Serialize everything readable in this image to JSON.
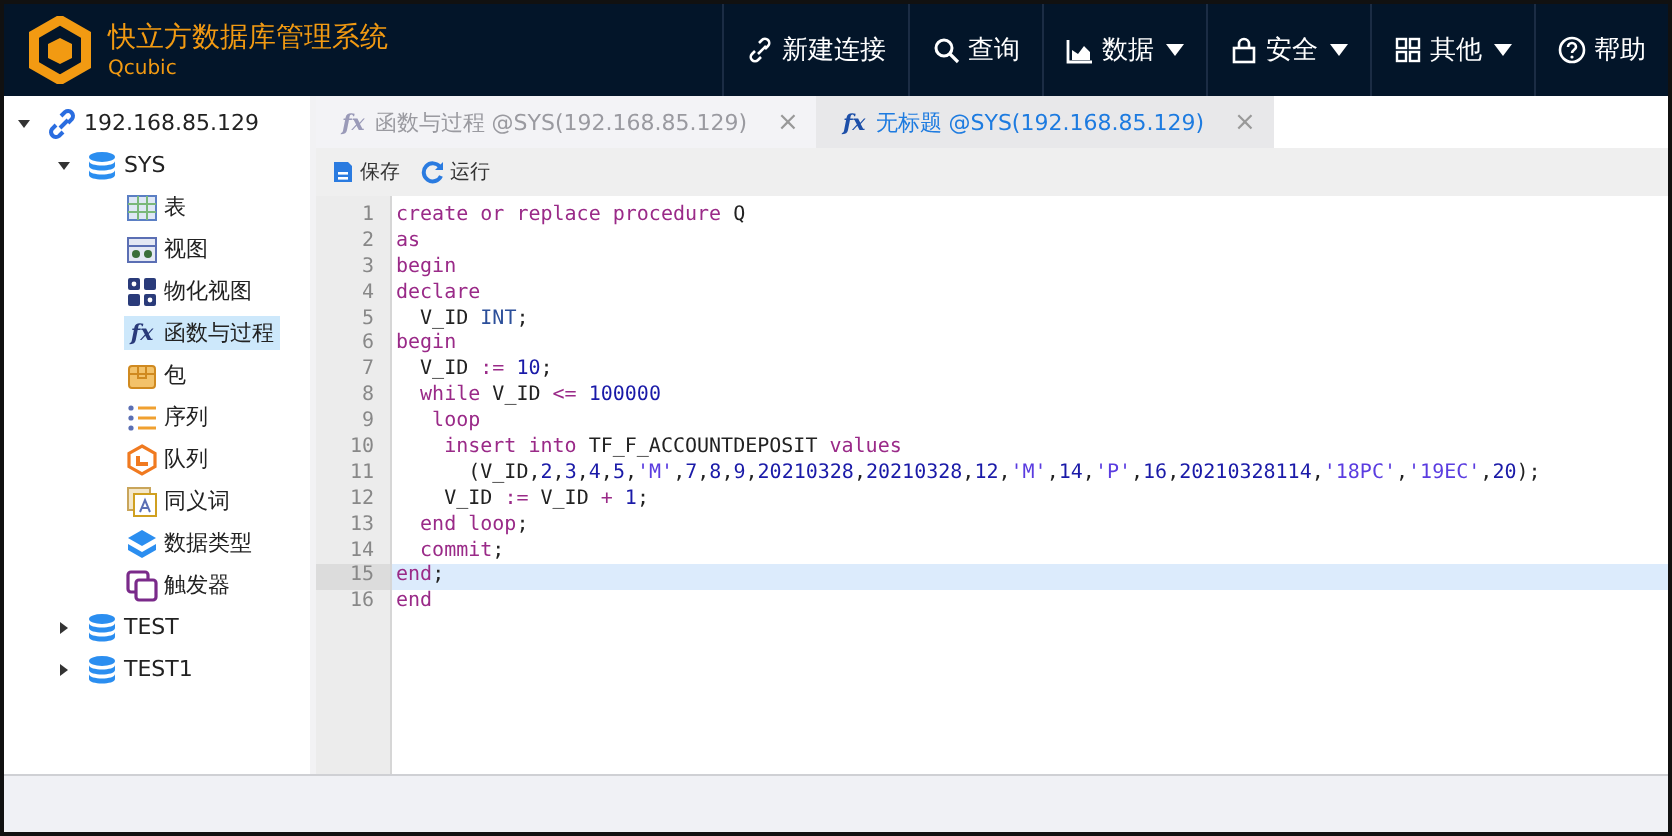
{
  "app": {
    "title": "快立方数据库管理系统",
    "subtitle": "Qcubic"
  },
  "nav": [
    {
      "kind": "link",
      "label": "新建连接",
      "dropdown": false
    },
    {
      "kind": "search",
      "label": "查询",
      "dropdown": false
    },
    {
      "kind": "chart",
      "label": "数据",
      "dropdown": true
    },
    {
      "kind": "lock",
      "label": "安全",
      "dropdown": true
    },
    {
      "kind": "grid",
      "label": "其他",
      "dropdown": true
    },
    {
      "kind": "help",
      "label": "帮助",
      "dropdown": false
    }
  ],
  "tree": [
    {
      "kind": "server",
      "label": "192.168.85.129",
      "expanded": true,
      "selected": false,
      "children": [
        {
          "kind": "database",
          "label": "SYS",
          "expanded": true,
          "selected": false,
          "children": [
            {
              "kind": "table",
              "label": "表",
              "selected": false
            },
            {
              "kind": "view",
              "label": "视图",
              "selected": false
            },
            {
              "kind": "mview",
              "label": "物化视图",
              "selected": false
            },
            {
              "kind": "function",
              "icon_text": "fx",
              "label": "函数与过程",
              "selected": true
            },
            {
              "kind": "package",
              "label": "包",
              "selected": false
            },
            {
              "kind": "sequence",
              "label": "序列",
              "selected": false
            },
            {
              "kind": "queue",
              "label": "队列",
              "selected": false
            },
            {
              "kind": "synonym",
              "label": "同义词",
              "selected": false
            },
            {
              "kind": "datatype",
              "label": "数据类型",
              "selected": false
            },
            {
              "kind": "trigger",
              "label": "触发器",
              "selected": false
            }
          ]
        },
        {
          "kind": "database",
          "label": "TEST",
          "expanded": false,
          "selected": false
        },
        {
          "kind": "database",
          "label": "TEST1",
          "expanded": false,
          "selected": false
        }
      ]
    }
  ],
  "tabs": [
    {
      "icon_text": "fx",
      "label": "函数与过程 @SYS(192.168.85.129)",
      "close": "×",
      "selected": false
    },
    {
      "icon_text": "fx",
      "label": "无标题 @SYS(192.168.85.129)",
      "close": "×",
      "selected": true
    }
  ],
  "toolbar": [
    {
      "kind": "save",
      "label": "保存"
    },
    {
      "kind": "run",
      "label": "运行"
    }
  ],
  "editor": {
    "lines": [
      {
        "number": "1",
        "active": false,
        "tokens": [
          {
            "kind": "kw",
            "text": "create or replace procedure"
          },
          {
            "kind": "plain",
            "text": " Q"
          }
        ]
      },
      {
        "number": "2",
        "active": false,
        "tokens": [
          {
            "kind": "kw",
            "text": "as"
          }
        ]
      },
      {
        "number": "3",
        "active": false,
        "tokens": [
          {
            "kind": "kw",
            "text": "begin"
          }
        ]
      },
      {
        "number": "4",
        "active": false,
        "tokens": [
          {
            "kind": "kw",
            "text": "declare"
          }
        ]
      },
      {
        "number": "5",
        "active": false,
        "tokens": [
          {
            "kind": "plain",
            "text": "  V_ID "
          },
          {
            "kind": "type",
            "text": "INT"
          },
          {
            "kind": "plain",
            "text": ";"
          }
        ]
      },
      {
        "number": "6",
        "active": false,
        "tokens": [
          {
            "kind": "kw",
            "text": "begin"
          }
        ]
      },
      {
        "number": "7",
        "active": false,
        "tokens": [
          {
            "kind": "plain",
            "text": "  V_ID "
          },
          {
            "kind": "op",
            "text": ":= "
          },
          {
            "kind": "num",
            "text": "10"
          },
          {
            "kind": "plain",
            "text": ";"
          }
        ]
      },
      {
        "number": "8",
        "active": false,
        "tokens": [
          {
            "kind": "kw",
            "text": "  while"
          },
          {
            "kind": "plain",
            "text": " V_ID "
          },
          {
            "kind": "op",
            "text": "<= "
          },
          {
            "kind": "num",
            "text": "100000"
          }
        ]
      },
      {
        "number": "9",
        "active": false,
        "tokens": [
          {
            "kind": "kw",
            "text": "   loop"
          }
        ]
      },
      {
        "number": "10",
        "active": false,
        "tokens": [
          {
            "kind": "kw",
            "text": "    insert into"
          },
          {
            "kind": "plain",
            "text": " TF_F_ACCOUNTDEPOSIT "
          },
          {
            "kind": "kw",
            "text": "values"
          }
        ]
      },
      {
        "number": "11",
        "active": false,
        "tokens": [
          {
            "kind": "plain",
            "text": "      (V_ID,"
          },
          {
            "kind": "num",
            "text": "2"
          },
          {
            "kind": "plain",
            "text": ","
          },
          {
            "kind": "num",
            "text": "3"
          },
          {
            "kind": "plain",
            "text": ","
          },
          {
            "kind": "num",
            "text": "4"
          },
          {
            "kind": "plain",
            "text": ","
          },
          {
            "kind": "num",
            "text": "5"
          },
          {
            "kind": "plain",
            "text": ","
          },
          {
            "kind": "str",
            "text": "'M'"
          },
          {
            "kind": "plain",
            "text": ","
          },
          {
            "kind": "num",
            "text": "7"
          },
          {
            "kind": "plain",
            "text": ","
          },
          {
            "kind": "num",
            "text": "8"
          },
          {
            "kind": "plain",
            "text": ","
          },
          {
            "kind": "num",
            "text": "9"
          },
          {
            "kind": "plain",
            "text": ","
          },
          {
            "kind": "num",
            "text": "20210328"
          },
          {
            "kind": "plain",
            "text": ","
          },
          {
            "kind": "num",
            "text": "20210328"
          },
          {
            "kind": "plain",
            "text": ","
          },
          {
            "kind": "num",
            "text": "12"
          },
          {
            "kind": "plain",
            "text": ","
          },
          {
            "kind": "str",
            "text": "'M'"
          },
          {
            "kind": "plain",
            "text": ","
          },
          {
            "kind": "num",
            "text": "14"
          },
          {
            "kind": "plain",
            "text": ","
          },
          {
            "kind": "str",
            "text": "'P'"
          },
          {
            "kind": "plain",
            "text": ","
          },
          {
            "kind": "num",
            "text": "16"
          },
          {
            "kind": "plain",
            "text": ","
          },
          {
            "kind": "num",
            "text": "20210328114"
          },
          {
            "kind": "plain",
            "text": ","
          },
          {
            "kind": "str",
            "text": "'18PC'"
          },
          {
            "kind": "plain",
            "text": ","
          },
          {
            "kind": "str",
            "text": "'19EC'"
          },
          {
            "kind": "plain",
            "text": ","
          },
          {
            "kind": "num",
            "text": "20"
          },
          {
            "kind": "plain",
            "text": ");"
          }
        ]
      },
      {
        "number": "12",
        "active": false,
        "tokens": [
          {
            "kind": "plain",
            "text": "    V_ID "
          },
          {
            "kind": "op",
            "text": ":="
          },
          {
            "kind": "plain",
            "text": " V_ID "
          },
          {
            "kind": "op",
            "text": "+ "
          },
          {
            "kind": "num",
            "text": "1"
          },
          {
            "kind": "plain",
            "text": ";"
          }
        ]
      },
      {
        "number": "13",
        "active": false,
        "tokens": [
          {
            "kind": "kw",
            "text": "  end loop"
          },
          {
            "kind": "plain",
            "text": ";"
          }
        ]
      },
      {
        "number": "14",
        "active": false,
        "tokens": [
          {
            "kind": "kw",
            "text": "  commit"
          },
          {
            "kind": "plain",
            "text": ";"
          }
        ]
      },
      {
        "number": "15",
        "active": true,
        "tokens": [
          {
            "kind": "kw",
            "text": "end"
          },
          {
            "kind": "plain",
            "text": ";"
          }
        ]
      },
      {
        "number": "16",
        "active": false,
        "tokens": [
          {
            "kind": "kw",
            "text": "end"
          }
        ]
      }
    ]
  }
}
